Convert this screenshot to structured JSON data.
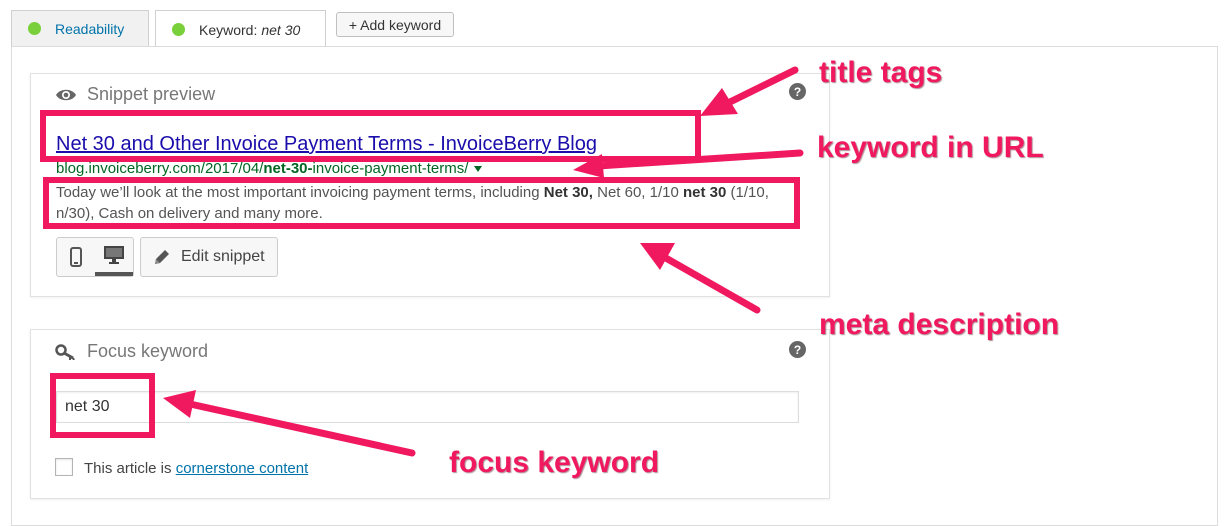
{
  "tabs": {
    "readability": {
      "label": "Readability",
      "status_color": "#7ad03a"
    },
    "keyword": {
      "label": "Keyword:",
      "keyword": "net 30",
      "status_color": "#7ad03a"
    },
    "add_keyword_label": "+ Add keyword"
  },
  "snippet": {
    "panel_title": "Snippet preview",
    "title_icon": "eye-icon",
    "help_icon": "help-icon",
    "serp_title": "Net 30 and Other Invoice Payment Terms - InvoiceBerry Blog",
    "url_prefix": "blog.invoiceberry.com/2017/04/",
    "url_bold": "net-30-",
    "url_suffix": "invoice-payment-terms/",
    "desc_1": "Today we’ll look at the most important invoicing payment terms, including ",
    "desc_2": "Net 30,",
    "desc_3": " Net 60, 1/10 ",
    "desc_4": "net 30",
    "desc_5": " (1/10, n/30), Cash on delivery and many more.",
    "mobile_icon": "mobile-icon",
    "desktop_icon": "desktop-icon",
    "edit_icon": "pencil-icon",
    "edit_label": "Edit snippet"
  },
  "focus": {
    "panel_title": "Focus keyword",
    "title_icon": "key-icon",
    "help_icon": "help-icon",
    "input_value": "net 30",
    "checkbox_label": "This article is ",
    "checkbox_link": "cornerstone content"
  },
  "annotations": {
    "title_tags": "title tags",
    "keyword_in_url": "keyword in URL",
    "meta_description": "meta description",
    "focus_keyword": "focus keyword",
    "color": "#f0195f"
  }
}
